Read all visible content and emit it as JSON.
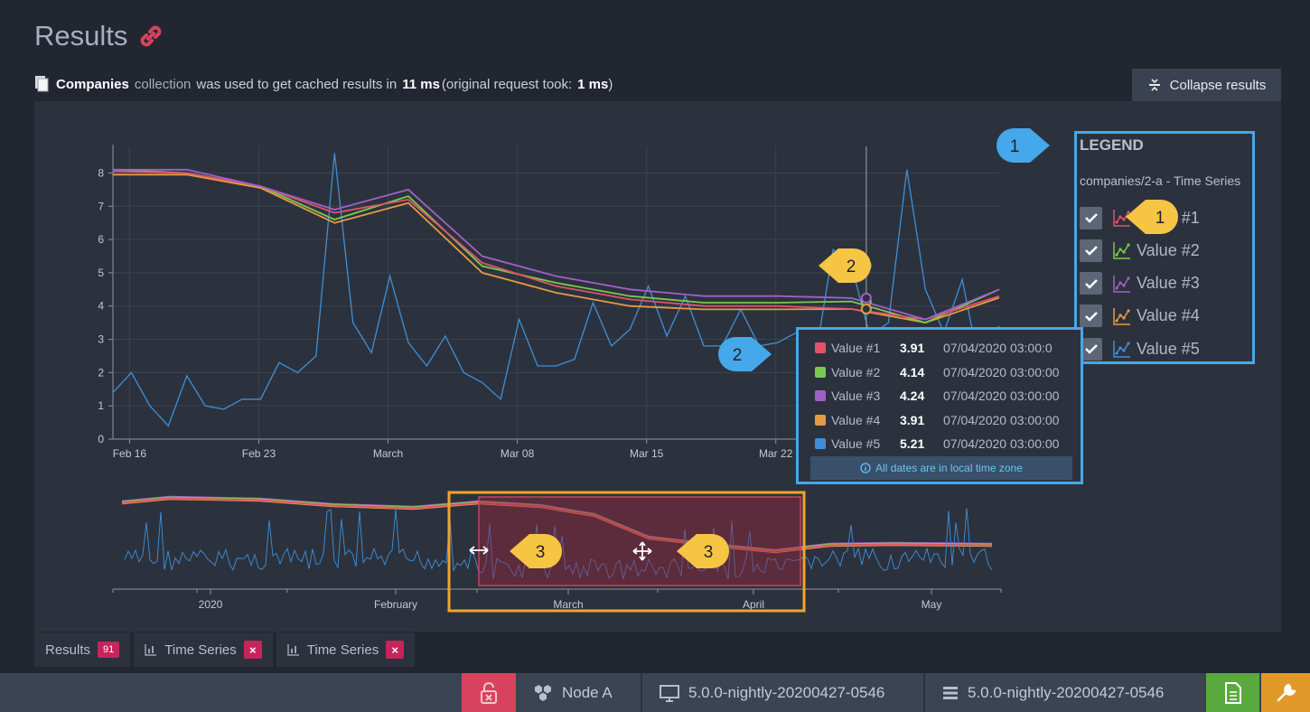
{
  "header": {
    "title": "Results",
    "info_collection": "Companies",
    "info_text1": "collection",
    "info_text2": "was used to get cached results in",
    "info_ms": "11 ms",
    "info_text3": "(original request took:",
    "info_orig_ms": "1 ms",
    "info_text4": ")",
    "collapse_label": "Collapse results"
  },
  "legend": {
    "title": "LEGEND",
    "subtitle": "companies/2-a - Time Series",
    "items": [
      {
        "label": "Value #1",
        "checked": true,
        "color": "#e0546a"
      },
      {
        "label": "Value #2",
        "checked": true,
        "color": "#7ac94f"
      },
      {
        "label": "Value #3",
        "checked": true,
        "color": "#a060c8"
      },
      {
        "label": "Value #4",
        "checked": true,
        "color": "#e59a45"
      },
      {
        "label": "Value #5",
        "checked": true,
        "color": "#3f8fd8"
      }
    ]
  },
  "tooltip": {
    "rows": [
      {
        "name": "Value #1",
        "value": "3.91",
        "date": "07/04/2020 03:00:0",
        "color": "#e0546a"
      },
      {
        "name": "Value #2",
        "value": "4.14",
        "date": "07/04/2020 03:00:00",
        "color": "#7ac94f"
      },
      {
        "name": "Value #3",
        "value": "4.24",
        "date": "07/04/2020 03:00:00",
        "color": "#a060c8"
      },
      {
        "name": "Value #4",
        "value": "3.91",
        "date": "07/04/2020 03:00:00",
        "color": "#e59a45"
      },
      {
        "name": "Value #5",
        "value": "5.21",
        "date": "07/04/2020 03:00:00",
        "color": "#3f8fd8"
      }
    ],
    "note": "All dates are in local time zone"
  },
  "callouts": [
    "1",
    "1",
    "2",
    "2",
    "3",
    "3"
  ],
  "tabs": [
    {
      "label": "Results",
      "badge": "91"
    },
    {
      "label": "Time Series",
      "close": "×"
    },
    {
      "label": "Time Series",
      "close": "×"
    }
  ],
  "statusbar": {
    "node": "Node A",
    "client_version": "5.0.0-nightly-20200427-0546",
    "server_version": "5.0.0-nightly-20200427-0546",
    "lock_color": "#d7435c",
    "doc_color": "#5aaa3f",
    "wrench_color": "#e19a2a"
  },
  "chart_data": {
    "type": "line",
    "main": {
      "x_ticks": [
        "Feb 16",
        "Feb 23",
        "March",
        "Mar 08",
        "Mar 15",
        "Mar 22"
      ],
      "y_ticks": [
        "0",
        "1",
        "2",
        "3",
        "4",
        "5",
        "6",
        "7",
        "8"
      ],
      "ylim": [
        0,
        8.8
      ],
      "grid": true,
      "x_day_range": [
        0,
        48
      ],
      "tick_days": [
        0.9,
        7.9,
        14.9,
        21.9,
        28.9,
        35.9
      ],
      "hover_day": 40.8,
      "series": [
        {
          "name": "Value #1",
          "color": "#e0546a",
          "days": [
            0,
            4,
            8,
            12,
            16,
            20,
            24,
            28,
            32,
            36,
            40,
            44,
            48
          ],
          "values": [
            8.05,
            8.0,
            7.6,
            6.8,
            7.2,
            5.3,
            4.6,
            4.2,
            4.0,
            4.0,
            3.91,
            3.6,
            4.3
          ]
        },
        {
          "name": "Value #2",
          "color": "#7ac94f",
          "days": [
            0,
            4,
            8,
            12,
            16,
            20,
            24,
            28,
            32,
            36,
            40,
            44,
            48
          ],
          "values": [
            8.1,
            8.0,
            7.6,
            6.6,
            7.3,
            5.2,
            4.7,
            4.3,
            4.1,
            4.1,
            4.14,
            3.5,
            4.5
          ]
        },
        {
          "name": "Value #3",
          "color": "#a060c8",
          "days": [
            0,
            4,
            8,
            12,
            16,
            20,
            24,
            28,
            32,
            36,
            40,
            44,
            48
          ],
          "values": [
            8.1,
            8.1,
            7.6,
            6.9,
            7.5,
            5.5,
            4.9,
            4.5,
            4.3,
            4.3,
            4.24,
            3.6,
            4.5
          ]
        },
        {
          "name": "Value #4",
          "color": "#e59a45",
          "days": [
            0,
            4,
            8,
            12,
            16,
            20,
            24,
            28,
            32,
            36,
            40,
            44,
            48
          ],
          "values": [
            7.95,
            7.95,
            7.55,
            6.5,
            7.1,
            5.0,
            4.4,
            4.0,
            3.9,
            3.9,
            3.91,
            3.5,
            4.25
          ]
        },
        {
          "name": "Value #5",
          "color": "#3f8fd8",
          "days": [
            0,
            1,
            2,
            3,
            4,
            5,
            6,
            7,
            8,
            9,
            10,
            11,
            12,
            13,
            14,
            15,
            16,
            17,
            18,
            19,
            20,
            21,
            22,
            23,
            24,
            25,
            26,
            27,
            28,
            29,
            30,
            31,
            32,
            33,
            34,
            35,
            36,
            37,
            38,
            39,
            40,
            41,
            42,
            43,
            44,
            45,
            46,
            47,
            48
          ],
          "values": [
            1.4,
            2.0,
            1.0,
            0.4,
            1.9,
            1.0,
            0.9,
            1.2,
            1.2,
            2.3,
            2.0,
            2.5,
            8.6,
            3.5,
            2.6,
            4.9,
            2.9,
            2.2,
            3.1,
            2.0,
            1.7,
            1.2,
            3.6,
            2.2,
            2.2,
            2.4,
            4.1,
            2.8,
            3.3,
            4.6,
            3.1,
            4.3,
            2.8,
            2.8,
            3.9,
            2.8,
            2.9,
            3.2,
            2.3,
            5.7,
            5.21,
            3.1,
            3.5,
            8.1,
            4.5,
            3.2,
            4.8,
            2.0,
            3.4
          ]
        }
      ]
    },
    "overview": {
      "x_ticks": [
        "2020",
        "February",
        "March",
        "April",
        "May"
      ]
    }
  }
}
